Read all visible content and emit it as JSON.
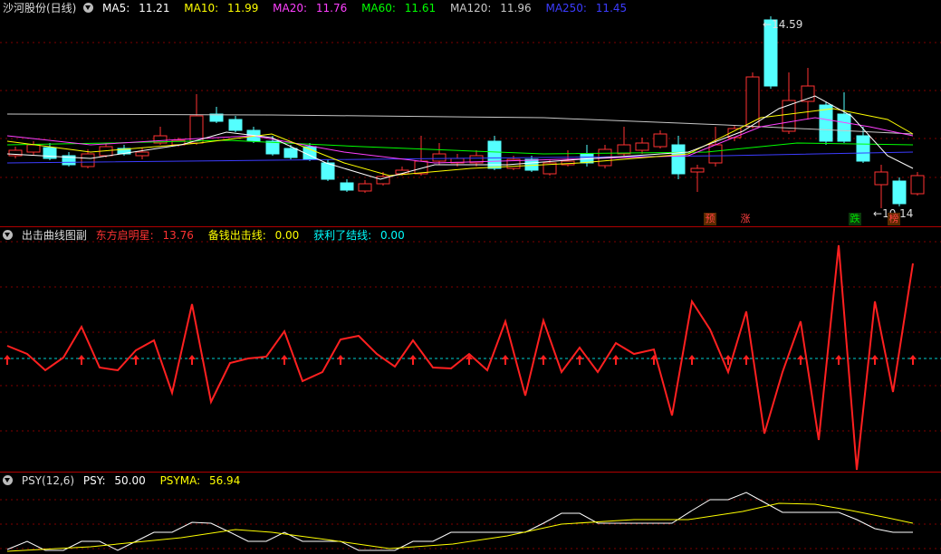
{
  "main": {
    "title": "沙河股份(日线)",
    "ma": [
      {
        "label": "MA5: ",
        "value": "11.21",
        "color": "#ffffff"
      },
      {
        "label": "MA10: ",
        "value": "11.99",
        "color": "#ffff00"
      },
      {
        "label": "MA20: ",
        "value": "11.76",
        "color": "#ff40ff"
      },
      {
        "label": "MA60: ",
        "value": "11.61",
        "color": "#00ff00"
      },
      {
        "label": "MA120: ",
        "value": "11.96",
        "color": "#c8c8c8"
      },
      {
        "label": "MA250: ",
        "value": "11.45",
        "color": "#2f2fff"
      }
    ],
    "high_label": "14.59",
    "low_label": "10.14",
    "markers": [
      {
        "text": "预",
        "color": "#ff4040"
      },
      {
        "text": "涨",
        "color": "#ff4040"
      },
      {
        "text": "跌",
        "color": "#00e000"
      },
      {
        "text": "榜",
        "color": "#ff4040"
      }
    ],
    "up_color": "#ff3232",
    "down_color": "#54ffff"
  },
  "ind1": {
    "title": "出击曲线图副",
    "items": [
      {
        "label": "东方启明星: ",
        "value": "13.76",
        "color": "#ff3232"
      },
      {
        "label": "备钱出击线: ",
        "value": "0.00",
        "color": "#ffff00"
      },
      {
        "label": "获利了结线: ",
        "value": "0.00",
        "color": "#00ffff"
      }
    ]
  },
  "ind2": {
    "title": "PSY(12,6)",
    "items": [
      {
        "label": "PSY: ",
        "value": "50.00",
        "color": "#ffffff"
      },
      {
        "label": "PSYMA: ",
        "value": "56.94",
        "color": "#ffff00"
      }
    ]
  }
}
